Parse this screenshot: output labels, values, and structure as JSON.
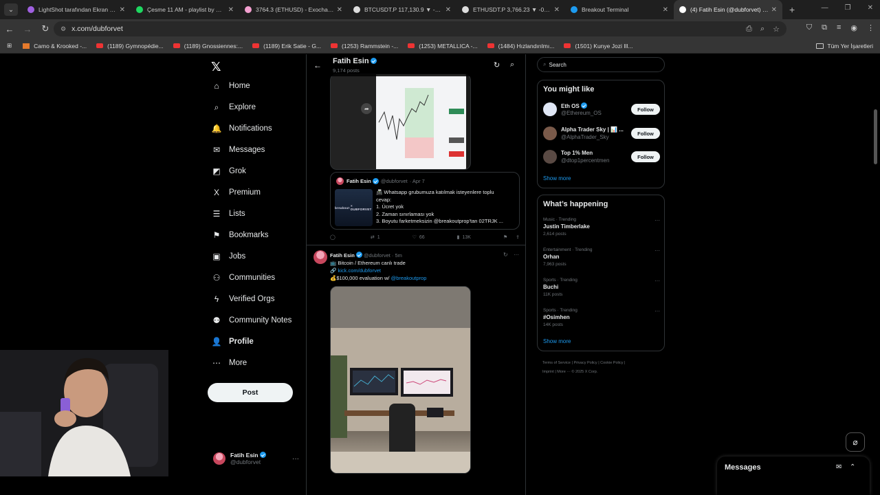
{
  "browser": {
    "tabs": [
      {
        "title": "LightShot tarafından Ekran Görü",
        "color": "#a060e0"
      },
      {
        "title": "Çesme 11 AM - playlist by Fatih",
        "color": "#1ed760"
      },
      {
        "title": "3764.3 (ETHUSD) - Exocharts",
        "color": "#f3a0d0"
      },
      {
        "title": "BTCUSDT.P 117,130.9 ▼ -0.67%",
        "color": "#dddddd"
      },
      {
        "title": "ETHUSDT.P 3,766.23 ▼ -0.69%",
        "color": "#dddddd"
      },
      {
        "title": "Breakout Terminal",
        "color": "#1d9bf0"
      },
      {
        "title": "(4) Fatih Esin (@dubforvet) / X",
        "color": "#ffffff"
      }
    ],
    "url": "x.com/dubforvet",
    "bookmarks": [
      "Camo & Krooked -...",
      "(1189) Gymnopédie...",
      "(1189) Gnossiennes:...",
      "(1189) Erik Satie - G...",
      "(1253) Rammstein -...",
      "(1253) METALLICA -...",
      "(1484) Hızlandırılmı...",
      "(1501) Kunye Jozi Ill..."
    ],
    "bookmarks_folder": "Tüm Yer İşaretleri"
  },
  "nav": {
    "items": [
      {
        "label": "Home",
        "icon": "home-icon",
        "glyph": "⌂"
      },
      {
        "label": "Explore",
        "icon": "search-icon",
        "glyph": "⌕"
      },
      {
        "label": "Notifications",
        "icon": "bell-icon",
        "glyph": "🔔"
      },
      {
        "label": "Messages",
        "icon": "mail-icon",
        "glyph": "✉"
      },
      {
        "label": "Grok",
        "icon": "grok-icon",
        "glyph": "◩"
      },
      {
        "label": "Premium",
        "icon": "x-icon",
        "glyph": "X"
      },
      {
        "label": "Lists",
        "icon": "list-icon",
        "glyph": "☰"
      },
      {
        "label": "Bookmarks",
        "icon": "bookmark-icon",
        "glyph": "⚑"
      },
      {
        "label": "Jobs",
        "icon": "briefcase-icon",
        "glyph": "▣"
      },
      {
        "label": "Communities",
        "icon": "people-icon",
        "glyph": "⚇"
      },
      {
        "label": "Verified Orgs",
        "icon": "lightning-icon",
        "glyph": "ϟ"
      },
      {
        "label": "Community Notes",
        "icon": "notes-icon",
        "glyph": "⚉"
      },
      {
        "label": "Profile",
        "icon": "person-icon",
        "glyph": "👤"
      },
      {
        "label": "More",
        "icon": "more-icon",
        "glyph": "⋯"
      }
    ],
    "post_label": "Post",
    "account_name": "Fatih Esin",
    "account_handle": "@dubforvet"
  },
  "profile_header": {
    "name": "Fatih Esin",
    "posts": "9,174 posts"
  },
  "quote": {
    "author": "Fatih Esin",
    "handle": "@dubforvet",
    "date": "· Apr 7",
    "thumb_label": "breakout",
    "thumb_label2": "× DUBFORVET",
    "lines": [
      "📠 Whatsapp grubumuza katılmak isteyenlere toplu",
      "cevap:",
      "1. Ücret yok",
      "2. Zaman sınırlaması yok",
      "3. Boyutu farketmeksizin @breakoutprop'tan 02TRJK ..."
    ]
  },
  "tweet1_actions": {
    "reply": "",
    "retweet": "1",
    "likes": "66",
    "views": "13K"
  },
  "tweet2": {
    "author": "Fatih Esin",
    "handle": "@dubforvet",
    "time": "· 5m",
    "line1": "📺 Bitcoin / Ethereum canlı trade",
    "link": "kick.com/dubforvet",
    "line3_text": "$100,000 evaluation w/ ",
    "line3_mention": "@breakoutprop"
  },
  "right": {
    "search_placeholder": "Search",
    "you_might_like": "You might like",
    "suggestions": [
      {
        "name": "Eth OS",
        "handle": "@Ethereum_OS",
        "follow": "Follow",
        "color": "#dfe6f5"
      },
      {
        "name": "Alpha Trader Sky | 📊 ...",
        "handle": "@AlphaTrader_Sky",
        "follow": "Follow",
        "color": "#7a5a4a"
      },
      {
        "name": "Top 1% Men",
        "handle": "@dtop1percentmen",
        "follow": "Follow",
        "color": "#5a4a44"
      }
    ],
    "show_more": "Show more",
    "whats_happening": "What’s happening",
    "trends": [
      {
        "category": "Music · Trending",
        "name": "Justin Timberlake",
        "posts": "2,614 posts"
      },
      {
        "category": "Entertainment · Trending",
        "name": "Orhan",
        "posts": "7,963 posts"
      },
      {
        "category": "Sports · Trending",
        "name": "Buchi",
        "posts": "11K posts"
      },
      {
        "category": "Sports · Trending",
        "name": "#Osimhen",
        "posts": "14K posts"
      }
    ],
    "show_more_2": "Show more",
    "footer_line1": "Terms of Service  |  Privacy Policy  |  Cookie Policy  |",
    "footer_line2": "Imprint  |  More ···  © 2025 X Corp."
  },
  "messages_drawer": {
    "title": "Messages"
  },
  "colors": {
    "accent": "#1d9bf0",
    "background": "#000000",
    "border": "#2f3336"
  }
}
